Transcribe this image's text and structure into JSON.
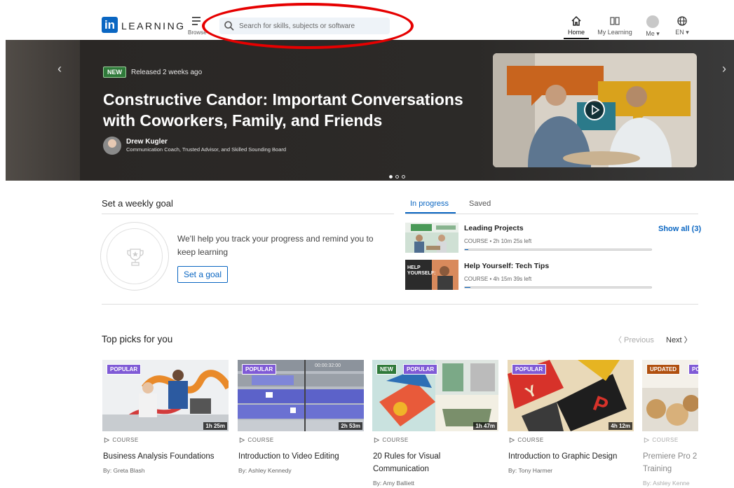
{
  "header": {
    "logo_in": "in",
    "logo_text": "LEARNING",
    "browse_label": "Browse",
    "search_placeholder": "Search for skills, subjects or software",
    "nav": {
      "home": "Home",
      "my_learning": "My Learning",
      "me": "Me ▾",
      "lang": "EN ▾"
    }
  },
  "hero": {
    "badge": "NEW",
    "released": "Released 2 weeks ago",
    "title": "Constructive Candor: Important Conversations with Coworkers, Family, and Friends",
    "author_name": "Drew Kugler",
    "author_role": "Communication Coach, Trusted Advisor, and Skilled Sounding Board",
    "prev_icon": "‹",
    "next_icon": "›",
    "dots_total": 3,
    "dots_active": 1
  },
  "goal": {
    "title": "Set a weekly goal",
    "text": "We'll help you track your progress and remind you to keep learning",
    "button": "Set a goal"
  },
  "progress": {
    "tabs": [
      "In progress",
      "Saved"
    ],
    "show_all": "Show all (3)",
    "items": [
      {
        "title": "Leading Projects",
        "meta": "COURSE • 2h 10m 25s left",
        "progress": 0.01
      },
      {
        "title": "Help Yourself: Tech Tips",
        "meta": "COURSE • 4h 15m 39s left",
        "progress": 0.03,
        "thumb_text": "HELP YOURSELF:"
      }
    ]
  },
  "picks": {
    "title": "Top picks for you",
    "previous": "〈 Previous",
    "next": "Next 〉",
    "cards": [
      {
        "badges": [
          "POPULAR"
        ],
        "duration": "1h 25m",
        "type": "COURSE",
        "title": "Business Analysis Foundations",
        "author": "By: Greta Blash"
      },
      {
        "badges": [
          "POPULAR"
        ],
        "duration": "2h 53m",
        "type": "COURSE",
        "title": "Introduction to Video Editing",
        "author": "By: Ashley Kennedy",
        "timecode": "00:00:32:00"
      },
      {
        "badges": [
          "NEW",
          "POPULAR"
        ],
        "duration": "1h 47m",
        "type": "COURSE",
        "title": "20 Rules for Visual Communication",
        "author": "By: Amy Balliett"
      },
      {
        "badges": [
          "POPULAR"
        ],
        "duration": "4h 12m",
        "type": "COURSE",
        "title": "Introduction to Graphic Design",
        "author": "By: Tony Harmer"
      },
      {
        "badges": [
          "UPDATED",
          "PO"
        ],
        "duration": "",
        "type": "COURSE",
        "title": "Premiere Pro 2 Training",
        "author": "By: Ashley Kenne"
      }
    ]
  },
  "colors": {
    "brand": "#0a66c2",
    "popular": "#7f5ad6",
    "new": "#2f7a3a",
    "updated": "#b0500f",
    "annotation": "#e60000"
  }
}
